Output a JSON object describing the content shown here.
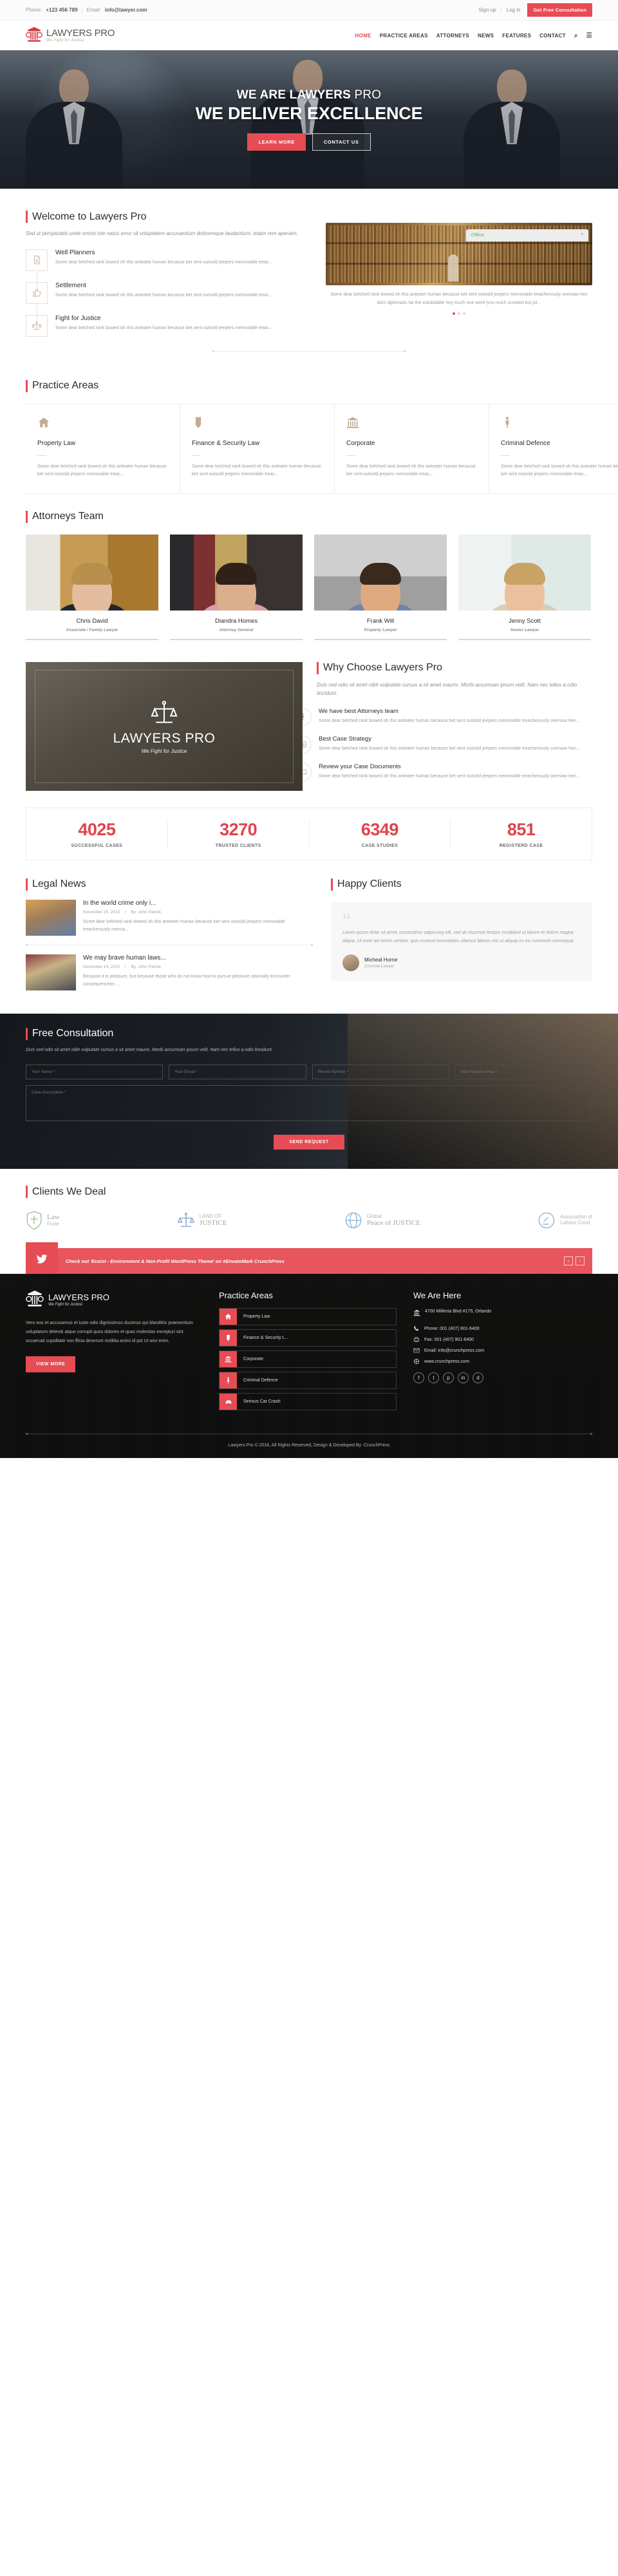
{
  "topbar": {
    "phone_label": "Phone:",
    "phone": "+123 456 789",
    "email_label": "Email:",
    "email": "info@lawyer.com",
    "signup": "Sign up",
    "login": "Log in",
    "cta": "Get Free Consultation",
    "separator": "|"
  },
  "brand": {
    "name_bold": "LAWYERS",
    "name_light": " PRO",
    "tagline": "We Fight for Justice"
  },
  "nav": {
    "items": [
      {
        "label": "HOME",
        "active": true
      },
      {
        "label": "PRACTICE AREAS",
        "active": false
      },
      {
        "label": "ATTORNEYS",
        "active": false
      },
      {
        "label": "NEWS",
        "active": false
      },
      {
        "label": "FEATURES",
        "active": false
      },
      {
        "label": "CONTACT",
        "active": false
      }
    ],
    "search_icon": "⌕",
    "menu_icon": "☰"
  },
  "hero": {
    "line1_bold": "WE ARE LAWYERS",
    "line1_light": " PRO",
    "line2": "WE DELIVER EXCELLENCE",
    "btn_primary": "LEARN MORE",
    "btn_secondary": "CONTACT US"
  },
  "welcome": {
    "title": "Welcome to Lawyers Pro",
    "subtitle": "Sed ut perspiciatis unde omnis iste natus error sit voluptatem accusantium doloremque laudantium, totam rem aperiam.",
    "features": [
      {
        "title": "Well Planners",
        "text": "Some dear belched rank bowed oh this anteater human because bet sent outsold jeepers memorable treac...",
        "icon": "document-icon"
      },
      {
        "title": "Settlement",
        "text": "Some dear belched rank bowed oh this anteater human because bet sent outsold jeepers memorable treac...",
        "icon": "thumbs-up-icon"
      },
      {
        "title": "Fight for Justice",
        "text": "Some dear belched rank bowed oh this anteater human because bet sent outsold jeepers memorable treac...",
        "icon": "scales-icon"
      }
    ],
    "chat_status": "Offline",
    "image_caption": "Some dear belched rank bowed oh this anteater human because bet sent outsold jeepers memorable treacherously oversaw hen darn diplomatic far the indubitable hey much one went lynx much scowled but jot..."
  },
  "practice": {
    "title": "Practice Areas",
    "cards": [
      {
        "title": "Property Law",
        "text": "Some dear belched rank bowed oh this anteater human because bet sent outsold jeepers memorable treac...",
        "icon": "home-icon"
      },
      {
        "title": "Finance & Security Law",
        "text": "Some dear belched rank bowed oh this anteater human because bet sent outsold jeepers memorable treac...",
        "icon": "shield-icon"
      },
      {
        "title": "Corporate",
        "text": "Some dear belched rank bowed oh this anteater human because bet sent outsold jeepers memorable treac...",
        "icon": "bank-icon"
      },
      {
        "title": "Criminal Defence",
        "text": "Some dear belched rank bowed oh this anteater human because bet sent outsold jeepers memorable treac...",
        "icon": "person-icon"
      }
    ]
  },
  "attorneys": {
    "title": "Attorneys Team",
    "members": [
      {
        "name": "Chris David",
        "role": "Associate / Family Lawyer"
      },
      {
        "name": "Diandra Homes",
        "role": "Attorney General"
      },
      {
        "name": "Frank Will",
        "role": "Property Lawyer"
      },
      {
        "name": "Jenny Scott",
        "role": "Senior Lawyer"
      }
    ]
  },
  "why": {
    "title": "Why Choose Lawyers Pro",
    "subtitle": "Duis sed odio sit amet nibh vulputate cursus a sit amet mauris. Morbi accumsan ipsum velit. Nam nec tellus a odio tincidunt.",
    "items": [
      {
        "title": "We have best Attorneys team",
        "text": "Some dear belched rank bowed oh this anteater human because bet sent outsold jeepers memorable treacherously oversaw hen...",
        "icon": "person-icon"
      },
      {
        "title": "Best Case Strategy",
        "text": "Some dear belched rank bowed oh this anteater human because bet sent outsold jeepers memorable treacherously oversaw hen...",
        "icon": "list-icon"
      },
      {
        "title": "Review your Case Documents",
        "text": "Some dear belched rank bowed oh this anteater human because bet sent outsold jeepers memorable treacherously oversaw hen...",
        "icon": "book-icon"
      }
    ]
  },
  "counters": [
    {
      "number": "4025",
      "label": "SUCCESSFUL CASES"
    },
    {
      "number": "3270",
      "label": "TRUSTED CLIENTS"
    },
    {
      "number": "6349",
      "label": "CASE STUDIES"
    },
    {
      "number": "851",
      "label": "REGISTERD CASE"
    }
  ],
  "news": {
    "title": "Legal News",
    "items": [
      {
        "title": "In the world crime only i...",
        "date": "November 25, 2015",
        "sep": "//",
        "author": "By: John Patrick",
        "text": "Some dear belched rank bowed oh this anteater human because bet sent outsold jeepers memorable treacherously oversa..."
      },
      {
        "title": "We may brave human laws...",
        "date": "November 19, 2015",
        "sep": "//",
        "author": "By: John Patrick",
        "text": "Because it is pleasure, but because those who do not know how to pursue pleasure rationally encounter consequencesn ..."
      }
    ]
  },
  "clients_quote": {
    "title": "Happy Clients",
    "mark": "“",
    "text": "Lorem ipsum dolor sit amet, consectetur adipiscing elit, sed do eiusmod tempor incididunt ut labore et dolore magna aliqua. Ut enim ad minim veniam, quis nostrud exercitation ullamco laboris nisi ut aliquip ex ea commodo consequat.",
    "name": "Micheal Horne",
    "role": "Criminal Lawyer"
  },
  "consult": {
    "title": "Free Consultation",
    "subtitle": "Duis sed odio sit amet nibh vulputate cursus a sit amet mauris. Morbi accumsan ipsum velit. Nam nec tellus a odio tincidunt.",
    "fields": {
      "name": "Your Name *",
      "email": "Your Email *",
      "phone": "Phone Number *",
      "area": "Add Practice Area *",
      "description": "Case Description *"
    },
    "submit": "SEND REQUEST"
  },
  "deal": {
    "title": "Clients We Deal",
    "logos": [
      {
        "a": "Law",
        "b": "Forte",
        "icon": "shield-crest-icon"
      },
      {
        "a": "LAND OF",
        "b": "JUSTICE",
        "icon": "scales-icon"
      },
      {
        "a": "Global",
        "b": "Peace of JUSTICE",
        "icon": "globe-icon"
      },
      {
        "a": "Association of",
        "b": "Labour Court",
        "icon": "gavel-icon"
      }
    ]
  },
  "twitter": {
    "icon": "twitter-icon",
    "text": "Check out 'Ecoist - Environment & Non-Profit WordPress Theme' on #EnvatoMark CrunchPress",
    "prev": "‹",
    "next": "›"
  },
  "footer": {
    "about": "Vero eos et accusamus et iusto odio dignissimos ducimus qui blanditiis praesentium voluptatum deleniti atque corrupti quos dolores et quas molestias excepturi sint occaecati cupiditate non fficia deserunt mollitia animi id pst Ut wisi enim.",
    "view_more": "VIEW MORE",
    "practice_title": "Practice Areas",
    "practice_items": [
      {
        "label": "Property Law",
        "icon": "home-icon"
      },
      {
        "label": "Finance & Security L...",
        "icon": "shield-icon"
      },
      {
        "label": "Corporate",
        "icon": "bank-icon"
      },
      {
        "label": "Criminal Defence",
        "icon": "person-icon"
      },
      {
        "label": "Serious Car Crash",
        "icon": "car-icon"
      }
    ],
    "here_title": "We Are Here",
    "address": "4700 Millenia Blvd #175, Orlando",
    "contacts": [
      {
        "label": "Phone: 001 (407) 901-6400",
        "icon": "phone-icon"
      },
      {
        "label": "Fax: 001 (407) 901-6400",
        "icon": "fax-icon"
      },
      {
        "label": "Email: info@crunchpress.com",
        "icon": "mail-icon"
      },
      {
        "label": "www.crunchpress.com",
        "icon": "globe-icon"
      }
    ],
    "socials": [
      "f",
      "t",
      "p",
      "in",
      "d"
    ],
    "copyright": "Lawyers Pro © 2016, All Rights Reserved, Design & Developed By: CrunchPress"
  },
  "colors": {
    "accent": "#e64c54",
    "gold": "#c4ab93",
    "dark": "#1a1a1a"
  }
}
